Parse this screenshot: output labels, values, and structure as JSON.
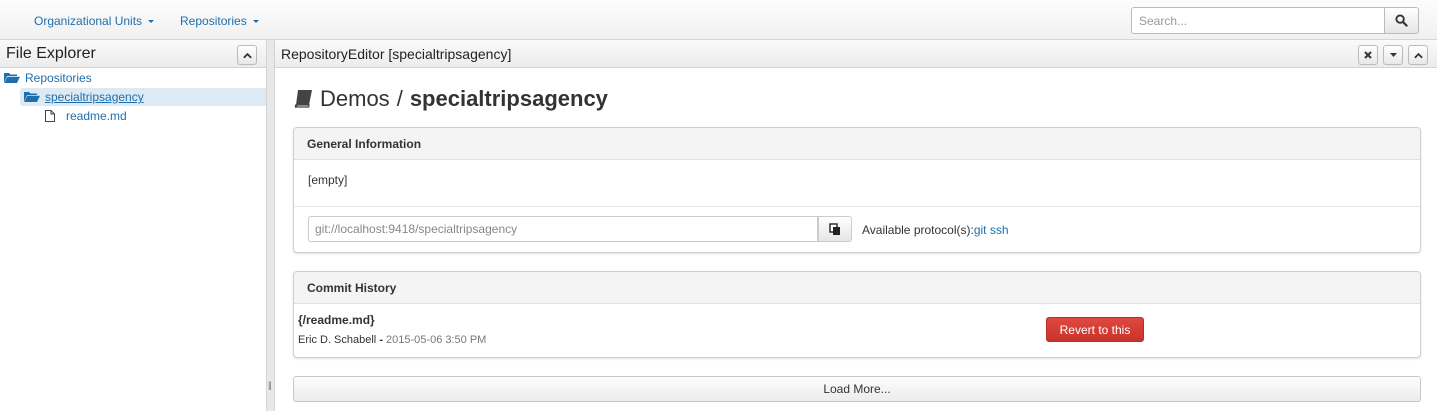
{
  "navbar": {
    "items": [
      {
        "label": "Organizational Units"
      },
      {
        "label": "Repositories"
      }
    ],
    "search": {
      "placeholder": "Search...",
      "icon": "search-icon"
    }
  },
  "file_explorer": {
    "title": "File Explorer",
    "tree": [
      {
        "label": "Repositories",
        "icon": "folder-open-icon"
      },
      {
        "label": "specialtripsagency",
        "icon": "folder-open-icon",
        "selected": true
      },
      {
        "label": "readme.md",
        "icon": "file-icon"
      }
    ]
  },
  "editor": {
    "title": "RepositoryEditor [specialtripsagency]",
    "heading": {
      "org": "Demos",
      "separator": "/",
      "repo": "specialtripsagency",
      "icon": "book-icon"
    },
    "general_info": {
      "title": "General Information",
      "description": "[empty]",
      "git_url": "git://localhost:9418/specialtripsagency",
      "protocols_label": "Available protocol(s):",
      "protocols": [
        "git",
        "ssh"
      ]
    },
    "commit_history": {
      "title": "Commit History",
      "commits": [
        {
          "file": "{/readme.md}",
          "author": "Eric D. Schabell",
          "separator": " - ",
          "date": "2015-05-06 3:50 PM",
          "action": "Revert to this"
        }
      ],
      "load_more": "Load More..."
    }
  },
  "colors": {
    "link": "#1f6fae",
    "danger": "#c9302c",
    "selected_bg": "#dde9f3"
  }
}
